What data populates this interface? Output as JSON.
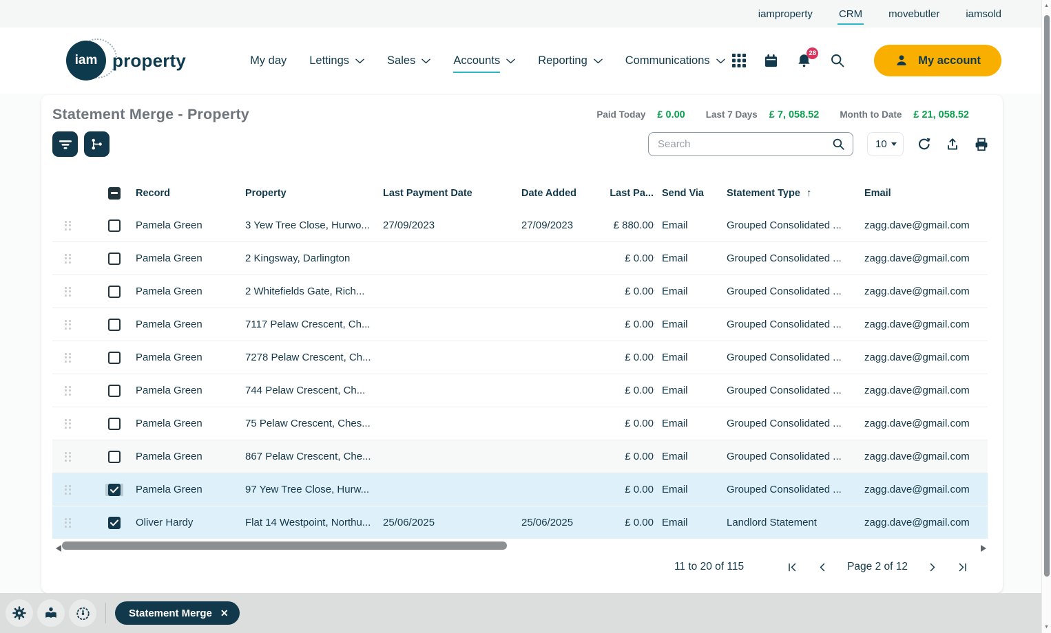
{
  "topbar": {
    "links": [
      {
        "label": "iamproperty",
        "active": false
      },
      {
        "label": "CRM",
        "active": true
      },
      {
        "label": "movebutler",
        "active": false
      },
      {
        "label": "iamsold",
        "active": false
      }
    ]
  },
  "header": {
    "logo": {
      "circle_text": "iam",
      "word": "property"
    },
    "nav": [
      {
        "label": "My day",
        "dropdown": false,
        "active": false
      },
      {
        "label": "Lettings",
        "dropdown": true,
        "active": false
      },
      {
        "label": "Sales",
        "dropdown": true,
        "active": false
      },
      {
        "label": "Accounts",
        "dropdown": true,
        "active": true
      },
      {
        "label": "Reporting",
        "dropdown": true,
        "active": false
      },
      {
        "label": "Communications",
        "dropdown": true,
        "active": false
      }
    ],
    "icons": [
      "apps-grid-icon",
      "calendar-icon",
      "bell-icon",
      "search-icon"
    ],
    "notification_count": "28",
    "account_button": "My account"
  },
  "page": {
    "title": "Statement Merge - Property",
    "stats": [
      {
        "label": "Paid Today",
        "value": "£ 0.00"
      },
      {
        "label": "Last 7 Days",
        "value": "£ 7, 058.52"
      },
      {
        "label": "Month to Date",
        "value": "£ 21, 058.52"
      }
    ]
  },
  "toolbar": {
    "filter_icon": "filter-icon",
    "merge_icon": "merge-icon",
    "search_placeholder": "Search",
    "search_value": "",
    "page_size": "10",
    "action_icons": [
      "refresh-icon",
      "export-icon",
      "print-icon"
    ]
  },
  "table": {
    "select_all_state": "indeterminate",
    "columns": [
      {
        "label": "Record",
        "key": "record"
      },
      {
        "label": "Property",
        "key": "property"
      },
      {
        "label": "Last Payment Date",
        "key": "last_payment_date"
      },
      {
        "label": "Date Added",
        "key": "date_added"
      },
      {
        "label": "Last Pa...",
        "key": "last_paid",
        "align": "right"
      },
      {
        "label": "Send Via",
        "key": "send_via"
      },
      {
        "label": "Statement Type",
        "key": "statement_type",
        "sort": "asc"
      },
      {
        "label": "Email",
        "key": "email"
      }
    ],
    "rows": [
      {
        "record": "Pamela Green",
        "property": "3 Yew Tree Close, Hurwo...",
        "last_payment_date": "27/09/2023",
        "date_added": "27/09/2023",
        "last_paid": "£ 880.00",
        "send_via": "Email",
        "statement_type": "Grouped Consolidated ...",
        "email": "zagg.dave@gmail.com",
        "checked": false,
        "selected": false,
        "hover": false,
        "focused": false
      },
      {
        "record": "Pamela Green",
        "property": "2 Kingsway, Darlington",
        "last_payment_date": "",
        "date_added": "",
        "last_paid": "£ 0.00",
        "send_via": "Email",
        "statement_type": "Grouped Consolidated ...",
        "email": "zagg.dave@gmail.com",
        "checked": false,
        "selected": false,
        "hover": false,
        "focused": false
      },
      {
        "record": "Pamela Green",
        "property": "2 Whitefields Gate, Rich...",
        "last_payment_date": "",
        "date_added": "",
        "last_paid": "£ 0.00",
        "send_via": "Email",
        "statement_type": "Grouped Consolidated ...",
        "email": "zagg.dave@gmail.com",
        "checked": false,
        "selected": false,
        "hover": false,
        "focused": false
      },
      {
        "record": "Pamela Green",
        "property": "7117 Pelaw Crescent, Ch...",
        "last_payment_date": "",
        "date_added": "",
        "last_paid": "£ 0.00",
        "send_via": "Email",
        "statement_type": "Grouped Consolidated ...",
        "email": "zagg.dave@gmail.com",
        "checked": false,
        "selected": false,
        "hover": false,
        "focused": false
      },
      {
        "record": "Pamela Green",
        "property": "7278 Pelaw Crescent, Ch...",
        "last_payment_date": "",
        "date_added": "",
        "last_paid": "£ 0.00",
        "send_via": "Email",
        "statement_type": "Grouped Consolidated ...",
        "email": "zagg.dave@gmail.com",
        "checked": false,
        "selected": false,
        "hover": false,
        "focused": false
      },
      {
        "record": "Pamela Green",
        "property": "744 Pelaw Crescent, Ch...",
        "last_payment_date": "",
        "date_added": "",
        "last_paid": "£ 0.00",
        "send_via": "Email",
        "statement_type": "Grouped Consolidated ...",
        "email": "zagg.dave@gmail.com",
        "checked": false,
        "selected": false,
        "hover": false,
        "focused": false
      },
      {
        "record": "Pamela Green",
        "property": "75 Pelaw Crescent, Ches...",
        "last_payment_date": "",
        "date_added": "",
        "last_paid": "£ 0.00",
        "send_via": "Email",
        "statement_type": "Grouped Consolidated ...",
        "email": "zagg.dave@gmail.com",
        "checked": false,
        "selected": false,
        "hover": false,
        "focused": false
      },
      {
        "record": "Pamela Green",
        "property": "867 Pelaw Crescent, Che...",
        "last_payment_date": "",
        "date_added": "",
        "last_paid": "£ 0.00",
        "send_via": "Email",
        "statement_type": "Grouped Consolidated ...",
        "email": "zagg.dave@gmail.com",
        "checked": false,
        "selected": false,
        "hover": true,
        "focused": false
      },
      {
        "record": "Pamela Green",
        "property": "97 Yew Tree Close, Hurw...",
        "last_payment_date": "",
        "date_added": "",
        "last_paid": "£ 0.00",
        "send_via": "Email",
        "statement_type": "Grouped Consolidated ...",
        "email": "zagg.dave@gmail.com",
        "checked": true,
        "selected": true,
        "hover": false,
        "focused": true
      },
      {
        "record": "Oliver Hardy",
        "property": "Flat 14 Westpoint, Northu...",
        "last_payment_date": "25/06/2025",
        "date_added": "25/06/2025",
        "last_paid": "£ 0.00",
        "send_via": "Email",
        "statement_type": "Landlord Statement",
        "email": "zagg.dave@gmail.com",
        "checked": true,
        "selected": true,
        "hover": false,
        "focused": false
      }
    ]
  },
  "pagination": {
    "range": "11 to 20 of 115",
    "page": "Page 2 of 12"
  },
  "bottombar": {
    "tab_label": "Statement Merge",
    "icons": [
      "gear-icon",
      "person-reading-icon",
      "gauge-icon"
    ]
  },
  "colors": {
    "ink": "#123a4c",
    "accent_teal": "#2ab8c6",
    "orange": "#f9af00",
    "green": "#0aa24e",
    "badge_red": "#d8365d",
    "selected_row": "#def0f9"
  }
}
